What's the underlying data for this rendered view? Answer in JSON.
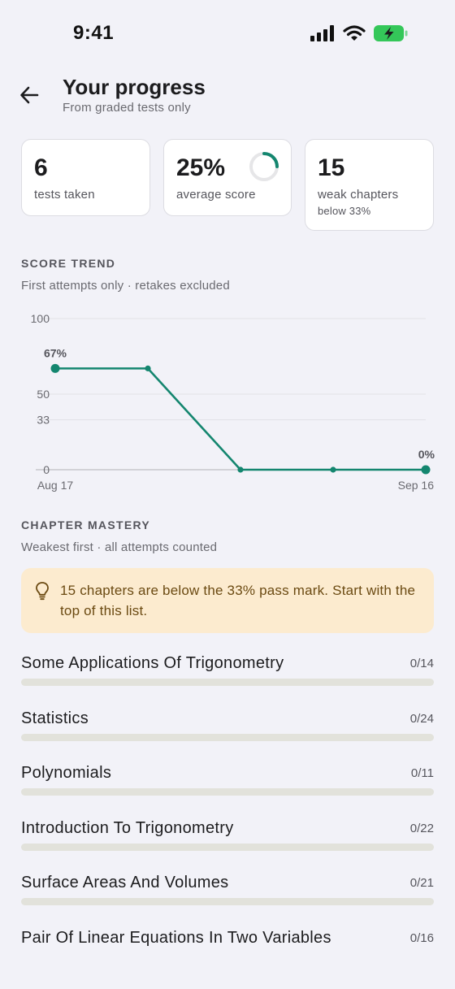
{
  "status_bar": {
    "time": "9:41"
  },
  "header": {
    "title": "Your progress",
    "subtitle": "From graded tests only"
  },
  "stats": {
    "tests_taken": {
      "value": "6",
      "label": "tests taken"
    },
    "average_score": {
      "value": "25%",
      "label": "average score",
      "fraction": 0.25
    },
    "weak_chapters": {
      "value": "15",
      "label": "weak chapters",
      "sub": "below 33%"
    }
  },
  "score_trend": {
    "heading": "SCORE TREND",
    "subtitle": "First attempts only · retakes excluded"
  },
  "chart_data": {
    "type": "line",
    "x": [
      "Aug 17",
      "",
      "",
      "",
      "Sep 16"
    ],
    "x_tick_labels": [
      "Aug 17",
      "Sep 16"
    ],
    "series": [
      {
        "values": [
          67,
          67,
          0,
          0,
          0
        ]
      }
    ],
    "point_labels": [
      "67%",
      "",
      "",
      "",
      "0%"
    ],
    "y_ticks": [
      0,
      33,
      50,
      100
    ],
    "ylim": [
      0,
      100
    ],
    "grid": true,
    "colors": {
      "line": "#14866f",
      "grid": "#e1e1e6",
      "baseline": "#c8c8cc"
    }
  },
  "chapter_mastery": {
    "heading": "CHAPTER MASTERY",
    "subtitle": "Weakest first · all attempts counted",
    "tip": "15 chapters are below the 33% pass mark. Start with the top of this list.",
    "chapters": [
      {
        "name": "Some Applications Of Trigonometry",
        "count": "0/14",
        "progress": 0
      },
      {
        "name": "Statistics",
        "count": "0/24",
        "progress": 0
      },
      {
        "name": "Polynomials",
        "count": "0/11",
        "progress": 0
      },
      {
        "name": "Introduction To Trigonometry",
        "count": "0/22",
        "progress": 0
      },
      {
        "name": "Surface Areas And Volumes",
        "count": "0/21",
        "progress": 0
      },
      {
        "name": "Pair Of Linear Equations In Two Variables",
        "count": "0/16",
        "progress": 0
      }
    ]
  },
  "colors": {
    "accent": "#14866f",
    "background": "#f2f2f8",
    "tip_background": "#fcebcf",
    "tip_text": "#6b4a12"
  }
}
